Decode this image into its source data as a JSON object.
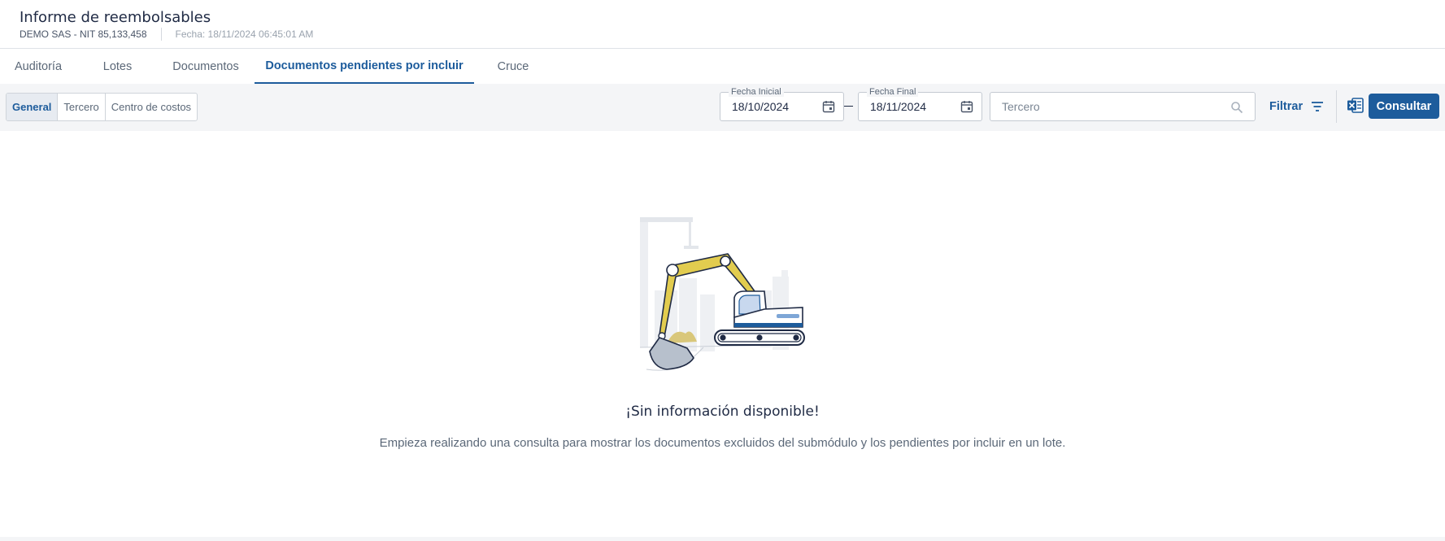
{
  "header": {
    "title": "Informe de reembolsables",
    "company": "DEMO SAS - NIT 85,133,458",
    "date": "Fecha: 18/11/2024 06:45:01 AM"
  },
  "tabs": [
    {
      "label": "Auditoría"
    },
    {
      "label": "Lotes"
    },
    {
      "label": "Documentos"
    },
    {
      "label": "Documentos pendientes por incluir",
      "active": true
    },
    {
      "label": "Cruce"
    }
  ],
  "segmented": [
    {
      "label": "General",
      "active": true
    },
    {
      "label": "Tercero"
    },
    {
      "label": "Centro de costos"
    }
  ],
  "filters": {
    "fecha_inicial": {
      "label": "Fecha Inicial",
      "value": "18/10/2024"
    },
    "fecha_final": {
      "label": "Fecha Final",
      "value": "18/11/2024"
    },
    "tercero_placeholder": "Tercero",
    "filtrar_label": "Filtrar",
    "consultar_label": "Consultar"
  },
  "empty_state": {
    "title": "¡Sin información disponible!",
    "description": "Empieza realizando una consulta para mostrar los documentos excluidos del submódulo y los pendientes por incluir en un lote."
  },
  "colors": {
    "primary": "#1d5c9c",
    "excavator": "#e2cc4f",
    "background": "#f4f5f7"
  },
  "icons": [
    "calendar-icon",
    "search-icon",
    "filter-icon",
    "excel-icon",
    "excavator-illustration"
  ]
}
